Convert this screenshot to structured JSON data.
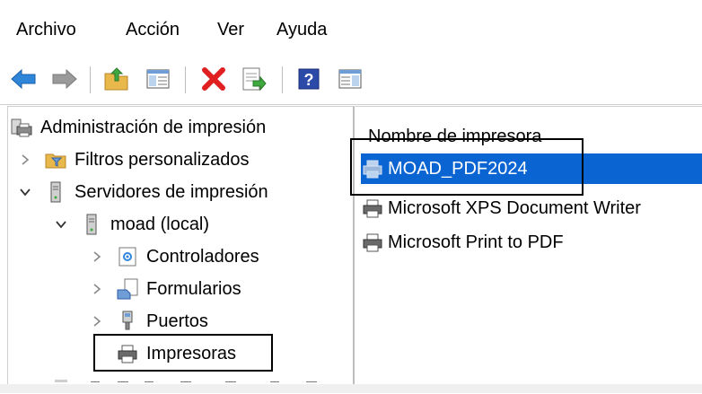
{
  "menu": {
    "file": "Archivo",
    "action": "Acción",
    "view": "Ver",
    "help": "Ayuda"
  },
  "toolbar_icons": [
    "back-icon",
    "forward-icon",
    "up-folder-icon",
    "show-hide-tree-icon",
    "delete-icon",
    "export-list-icon",
    "help-icon",
    "show-hide-action-pane-icon"
  ],
  "tree": {
    "root": "Administración de impresión",
    "custom_filters": "Filtros personalizados",
    "print_servers": "Servidores de impresión",
    "server": "moad (local)",
    "drivers": "Controladores",
    "forms": "Formularios",
    "ports": "Puertos",
    "printers": "Impresoras"
  },
  "list": {
    "column_header": "Nombre de impresora",
    "rows": [
      "MOAD_PDF2024",
      "Microsoft XPS Document Writer",
      "Microsoft Print to PDF"
    ]
  },
  "colors": {
    "selection": "#0a64d2",
    "folder": "#e8b84a",
    "delete": "#e02020",
    "arrow": "#2f86d8"
  }
}
